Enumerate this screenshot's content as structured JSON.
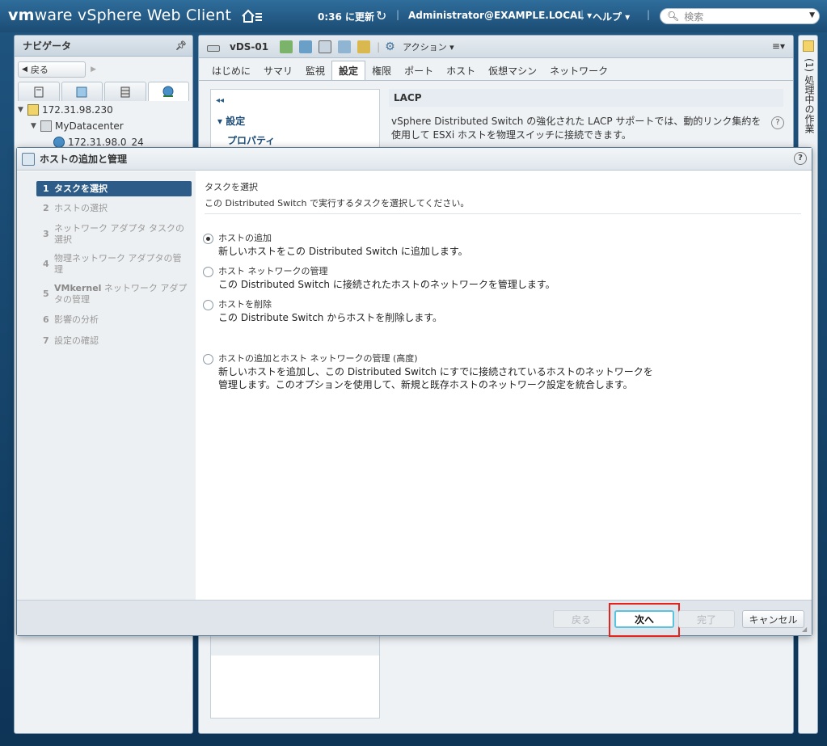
{
  "header": {
    "brand_vm": "vm",
    "brand_ware": "ware",
    "brand_product": " vSphere Web Client",
    "refresh_time": "0:36 に更新",
    "user": "Administrator@EXAMPLE.LOCAL ▾",
    "help": "ヘルプ ▾",
    "search_placeholder": "検索"
  },
  "navigator": {
    "title": "ナビゲータ",
    "back_label": "戻る",
    "tree": [
      {
        "label": "172.31.98.230",
        "icon": "vcenter-icon"
      },
      {
        "label": "MyDatacenter",
        "icon": "datacenter-icon"
      },
      {
        "label": "172.31.98.0_24",
        "icon": "network-icon"
      }
    ]
  },
  "main": {
    "object_title": "vDS-01",
    "actions_label": "アクション ▾",
    "tabs": [
      "はじめに",
      "サマリ",
      "監視",
      "設定",
      "権限",
      "ポート",
      "ホスト",
      "仮想マシン",
      "ネットワーク"
    ],
    "active_tab": "設定",
    "settings_section": "設定",
    "settings_item": "プロパティ",
    "lacp_title": "LACP",
    "lacp_desc": "vSphere Distributed Switch の強化された LACP サポートでは、動的リンク集約を使用して ESXi ホストを物理スイッチに接続できます。"
  },
  "task_strip": {
    "label": "(1) 処理中の作業"
  },
  "dialog": {
    "title": "ホストの追加と管理",
    "steps": [
      {
        "num": "1",
        "label": "タスクを選択"
      },
      {
        "num": "2",
        "label": "ホストの選択"
      },
      {
        "num": "3",
        "label": "ネットワーク アダプタ タスクの選択"
      },
      {
        "num": "4",
        "label": "物理ネットワーク アダプタの管理"
      },
      {
        "num": "5",
        "label_bold": "VMkernel",
        "label": " ネットワーク アダプタの管理"
      },
      {
        "num": "6",
        "label": "影響の分析"
      },
      {
        "num": "7",
        "label": "設定の確認"
      }
    ],
    "heading": "タスクを選択",
    "subheading": "この Distributed Switch で実行するタスクを選択してください。",
    "options": [
      {
        "label": "ホストの追加",
        "desc": "新しいホストをこの Distributed Switch に追加します。",
        "checked": true
      },
      {
        "label": "ホスト ネットワークの管理",
        "desc": "この Distributed Switch に接続されたホストのネットワークを管理します。",
        "checked": false
      },
      {
        "label": "ホストを削除",
        "desc": "この Distribute Switch からホストを削除します。",
        "checked": false
      },
      {
        "label": "ホストの追加とホスト ネットワークの管理 (高度)",
        "desc": "新しいホストを追加し、この Distributed Switch にすでに接続されているホストのネットワークを管理します。このオプションを使用して、新規と既存ホストのネットワーク設定を統合します。",
        "checked": false
      }
    ],
    "buttons": {
      "back": "戻る",
      "next": "次へ",
      "finish": "完了",
      "cancel": "キャンセル"
    }
  }
}
